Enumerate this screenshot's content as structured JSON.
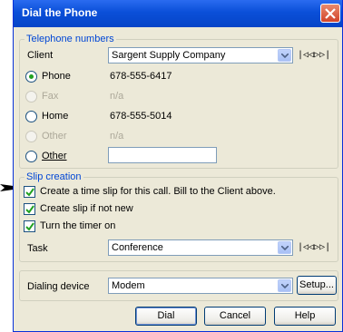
{
  "window": {
    "title": "Dial the Phone"
  },
  "telephone": {
    "legend": "Telephone numbers",
    "client_label": "Client",
    "client_value": "Sargent Supply Company",
    "nav_glyphs": "|◁◁▷▷|",
    "options": [
      {
        "label": "Phone",
        "value": "678-555-6417",
        "selected": true,
        "enabled": true
      },
      {
        "label": "Fax",
        "value": "n/a",
        "selected": false,
        "enabled": false
      },
      {
        "label": "Home",
        "value": "678-555-5014",
        "selected": false,
        "enabled": true
      },
      {
        "label": "Other",
        "value": "n/a",
        "selected": false,
        "enabled": false
      },
      {
        "label": "Other",
        "value": "",
        "selected": false,
        "enabled": true
      }
    ]
  },
  "slip": {
    "legend": "Slip creation",
    "checkboxes": [
      {
        "label": "Create a time slip for this call. Bill to the Client above.",
        "checked": true
      },
      {
        "label": "Create slip if not new",
        "checked": true
      },
      {
        "label": "Turn the timer on",
        "checked": true
      }
    ],
    "task_label": "Task",
    "task_value": "Conference",
    "nav_glyphs": "|◁◁▷▷|"
  },
  "dialing": {
    "label": "Dialing device",
    "value": "Modem",
    "setup_label": "Setup..."
  },
  "buttons": {
    "dial": "Dial",
    "cancel": "Cancel",
    "help": "Help"
  },
  "colors": {
    "title_bar": "#0a4fd8",
    "legend_text": "#0046d5",
    "close_button": "#d2442a"
  }
}
